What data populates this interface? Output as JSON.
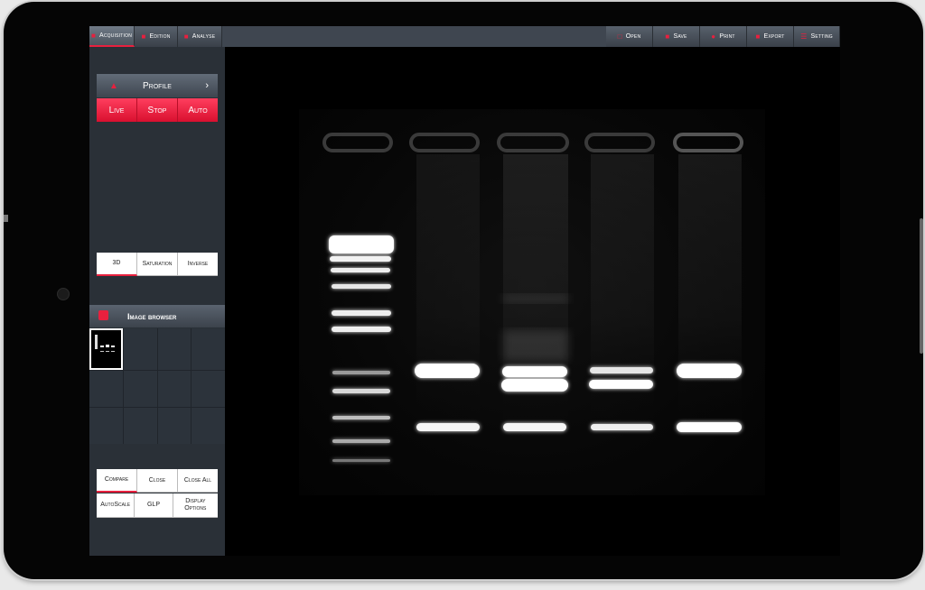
{
  "tabs": [
    {
      "label": "Acquisition",
      "icon": "acquisition-icon"
    },
    {
      "label": "Edition",
      "icon": "edition-icon"
    },
    {
      "label": "Analyse",
      "icon": "analyse-icon"
    }
  ],
  "tools": [
    {
      "label": "Open",
      "icon": "open-icon"
    },
    {
      "label": "Save",
      "icon": "save-icon"
    },
    {
      "label": "Print",
      "icon": "print-icon"
    },
    {
      "label": "Export",
      "icon": "export-icon"
    },
    {
      "label": "Setting",
      "icon": "setting-icon"
    }
  ],
  "sidebar": {
    "profile_label": "Profile",
    "capture": [
      "Live",
      "Stop",
      "Auto"
    ],
    "view": [
      "3D",
      "Saturation",
      "Inverse"
    ],
    "image_browser_title": "Image browser",
    "actions1": [
      "Compare",
      "Close",
      "Close All"
    ],
    "actions2": [
      "AutoScale",
      "GLP",
      "Display Options"
    ]
  },
  "colors": {
    "accent": "#e8203e",
    "toolbar": "#3f4650",
    "panel": "#2a3037"
  }
}
